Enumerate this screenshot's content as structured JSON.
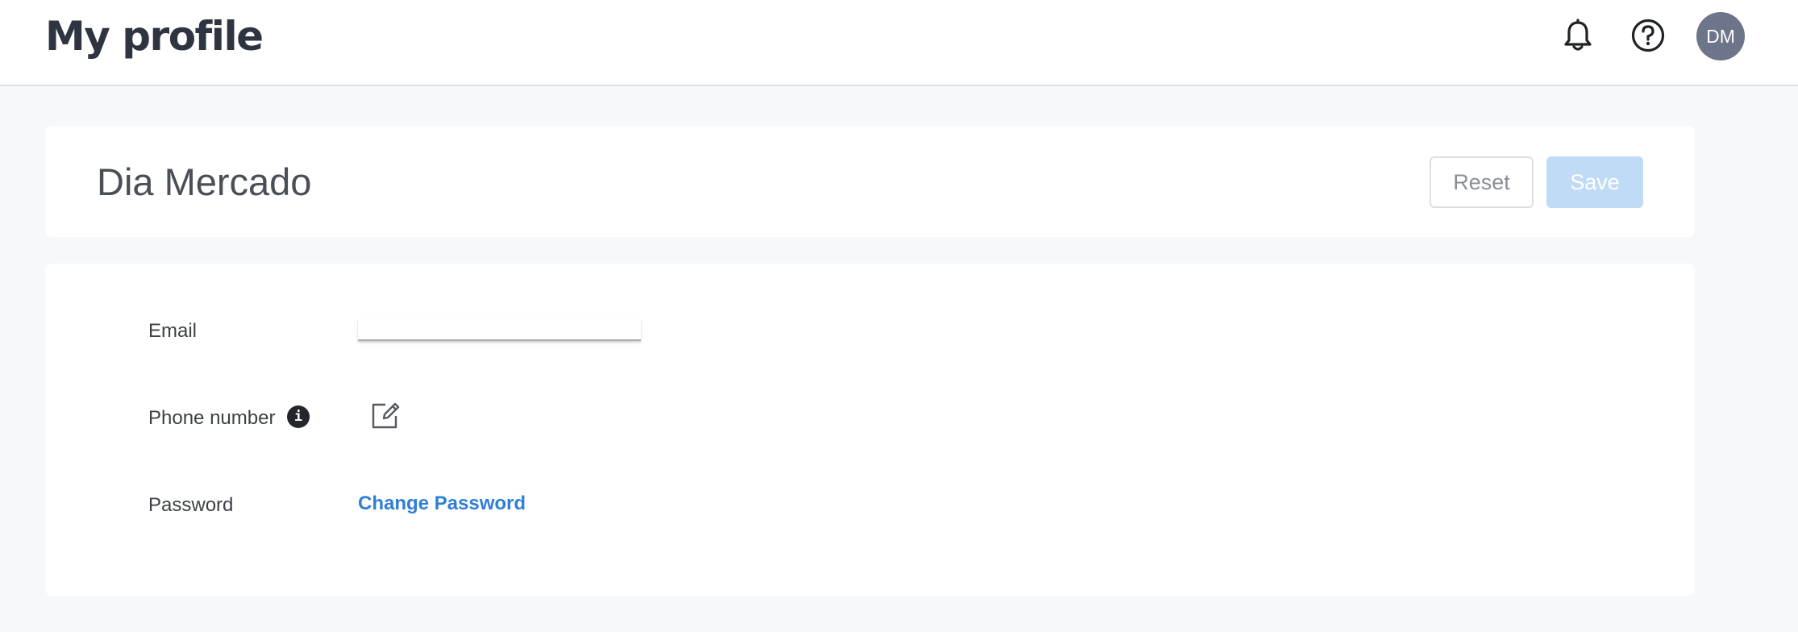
{
  "header": {
    "title": "My profile",
    "icons": [
      "bell-icon",
      "help-icon"
    ],
    "avatar_initials": "DM"
  },
  "profile": {
    "name": "Dia Mercado",
    "reset_label": "Reset",
    "save_label": "Save"
  },
  "form": {
    "email_label": "Email",
    "email_value": "",
    "phone_label": "Phone number",
    "phone_info_glyph": "i",
    "password_label": "Password",
    "change_password_label": "Change Password"
  },
  "colors": {
    "accent": "#2f7fd6",
    "save_disabled": "#c0dbf5",
    "avatar_bg": "#6c7589",
    "page_bg": "#f7f8f9"
  }
}
